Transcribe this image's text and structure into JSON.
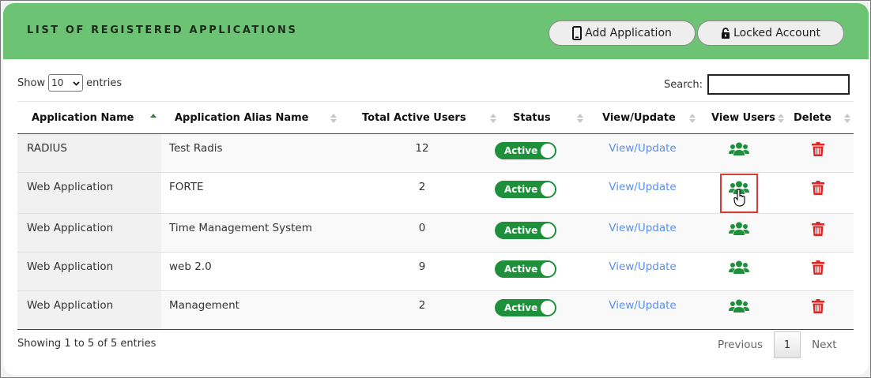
{
  "header": {
    "title": "LIST OF REGISTERED APPLICATIONS",
    "add_button": "Add Application",
    "locked_button": "Locked Account"
  },
  "controls": {
    "show_label": "Show",
    "show_value": "10",
    "entries_label": "entries",
    "search_label": "Search:",
    "search_value": ""
  },
  "table": {
    "columns": [
      "Application Name",
      "Application Alias Name",
      "Total Active Users",
      "Status",
      "View/Update",
      "View Users",
      "Delete"
    ],
    "rows": [
      {
        "name": "RADIUS",
        "alias": "Test Radis",
        "users": "12",
        "status": "Active",
        "view": "View/Update"
      },
      {
        "name": "Web Application",
        "alias": "FORTE",
        "users": "2",
        "status": "Active",
        "view": "View/Update"
      },
      {
        "name": "Web Application",
        "alias": "Time Management System",
        "users": "0",
        "status": "Active",
        "view": "View/Update"
      },
      {
        "name": "Web Application",
        "alias": "web 2.0",
        "users": "9",
        "status": "Active",
        "view": "View/Update"
      },
      {
        "name": "Web Application",
        "alias": "Management",
        "users": "2",
        "status": "Active",
        "view": "View/Update"
      }
    ]
  },
  "footer": {
    "info": "Showing 1 to 5 of 5 entries",
    "previous": "Previous",
    "page": "1",
    "next": "Next"
  },
  "colors": {
    "header_bg": "#6cc373",
    "toggle_active": "#1e8f3a",
    "users_icon": "#1e8f3a",
    "delete_icon": "#e02424",
    "link": "#5b8fe8",
    "highlight_box": "#d93a3a"
  },
  "icons": {
    "add_button": "mobile-phone-icon",
    "locked_button": "unlock-icon",
    "view_users": "users-group-icon",
    "delete": "trash-icon"
  }
}
